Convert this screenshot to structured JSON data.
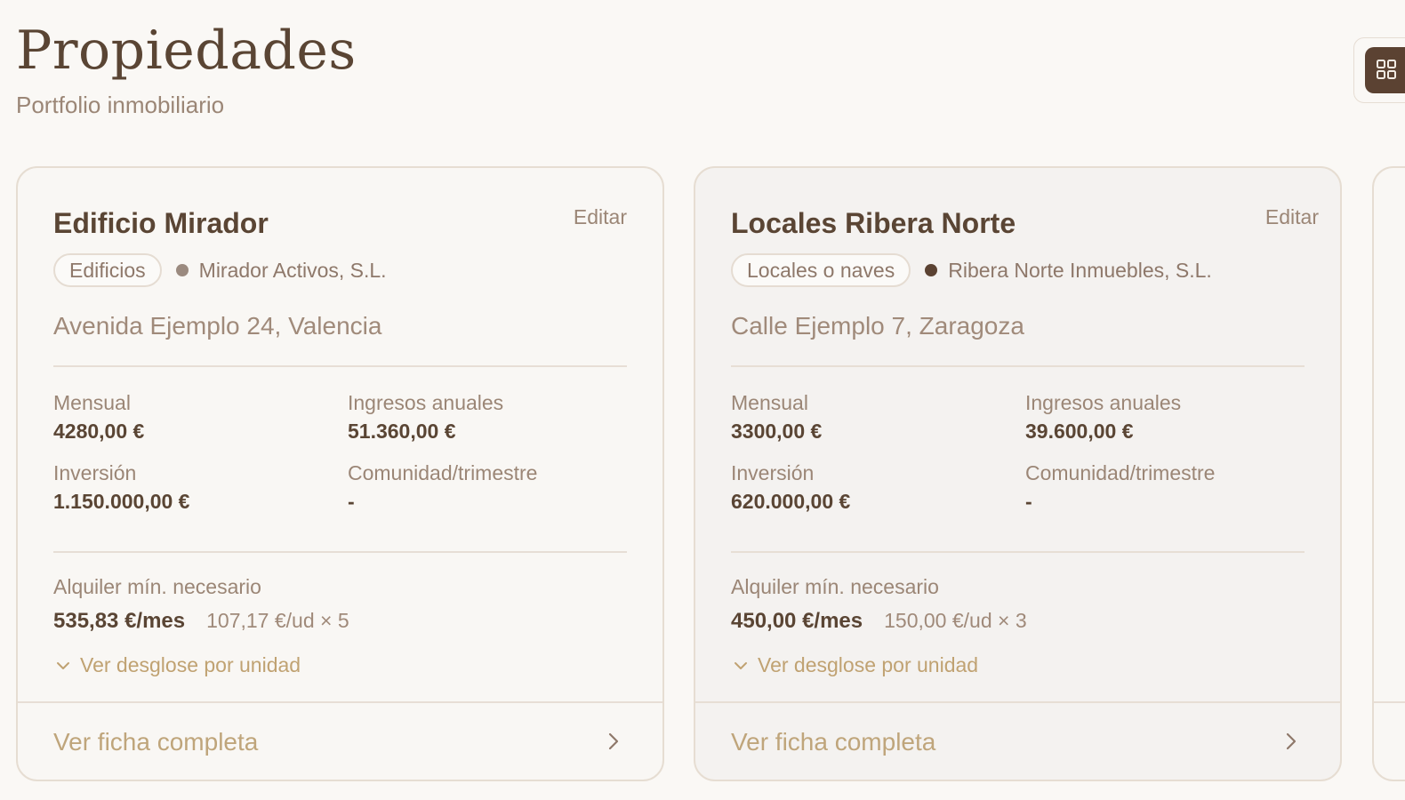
{
  "header": {
    "title": "Propiedades",
    "subtitle": "Portfolio inmobiliario"
  },
  "view_toggle": {
    "icon": "grid-icon"
  },
  "colors": {
    "background": "#faf8f5",
    "accent_dark": "#5b4232",
    "accent_gold": "#c0a272",
    "text_muted": "#9b8676"
  },
  "cards": [
    {
      "title": "Edificio Mirador",
      "edit_label": "Editar",
      "tag": "Edificios",
      "owner": "Mirador Activos, S.L.",
      "address": "Avenida Ejemplo 24, Valencia",
      "monthly_label": "Mensual",
      "monthly_value": "4280,00 €",
      "annual_label": "Ingresos anuales",
      "annual_value": "51.360,00 €",
      "investment_label": "Inversión",
      "investment_value": "1.150.000,00 €",
      "community_label": "Comunidad/trimestre",
      "community_value": "-",
      "min_rent_label": "Alquiler mín. necesario",
      "min_rent_value": "535,83 €/mes",
      "min_rent_detail": "107,17 €/ud × 5",
      "breakdown_label": "Ver desglose por unidad",
      "footer_label": "Ver ficha completa"
    },
    {
      "title": "Locales Ribera Norte",
      "edit_label": "Editar",
      "tag": "Locales o naves",
      "owner": "Ribera Norte Inmuebles, S.L.",
      "address": "Calle Ejemplo 7, Zaragoza",
      "monthly_label": "Mensual",
      "monthly_value": "3300,00 €",
      "annual_label": "Ingresos anuales",
      "annual_value": "39.600,00 €",
      "investment_label": "Inversión",
      "investment_value": "620.000,00 €",
      "community_label": "Comunidad/trimestre",
      "community_value": "-",
      "min_rent_label": "Alquiler mín. necesario",
      "min_rent_value": "450,00 €/mes",
      "min_rent_detail": "150,00 €/ud × 3",
      "breakdown_label": "Ver desglose por unidad",
      "footer_label": "Ver ficha completa"
    }
  ]
}
